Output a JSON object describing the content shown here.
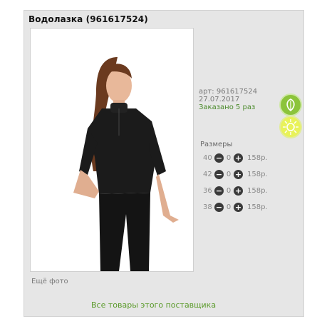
{
  "product": {
    "title": "Водолазка (961617524)",
    "more_photo": "Ещё фото",
    "article": "арт: 961617524",
    "date": "27.07.2017",
    "ordered": "Заказано 5 раз"
  },
  "sizes": {
    "heading": "Размеры",
    "rows": [
      {
        "size": "40",
        "qty": "0",
        "price": "158р."
      },
      {
        "size": "42",
        "qty": "0",
        "price": "158р."
      },
      {
        "size": "36",
        "qty": "0",
        "price": "158р."
      },
      {
        "size": "38",
        "qty": "0",
        "price": "158р."
      }
    ]
  },
  "icons": {
    "minus": "minus-icon",
    "plus": "plus-icon",
    "leaf": "leaf-icon",
    "sun": "sun-icon"
  },
  "colors": {
    "accent_green": "#5a9a2a",
    "leaf_badge": "#8cc43b",
    "sun_badge": "#e8f25a"
  },
  "footer": {
    "all_link": "Все товары этого поставщика"
  }
}
